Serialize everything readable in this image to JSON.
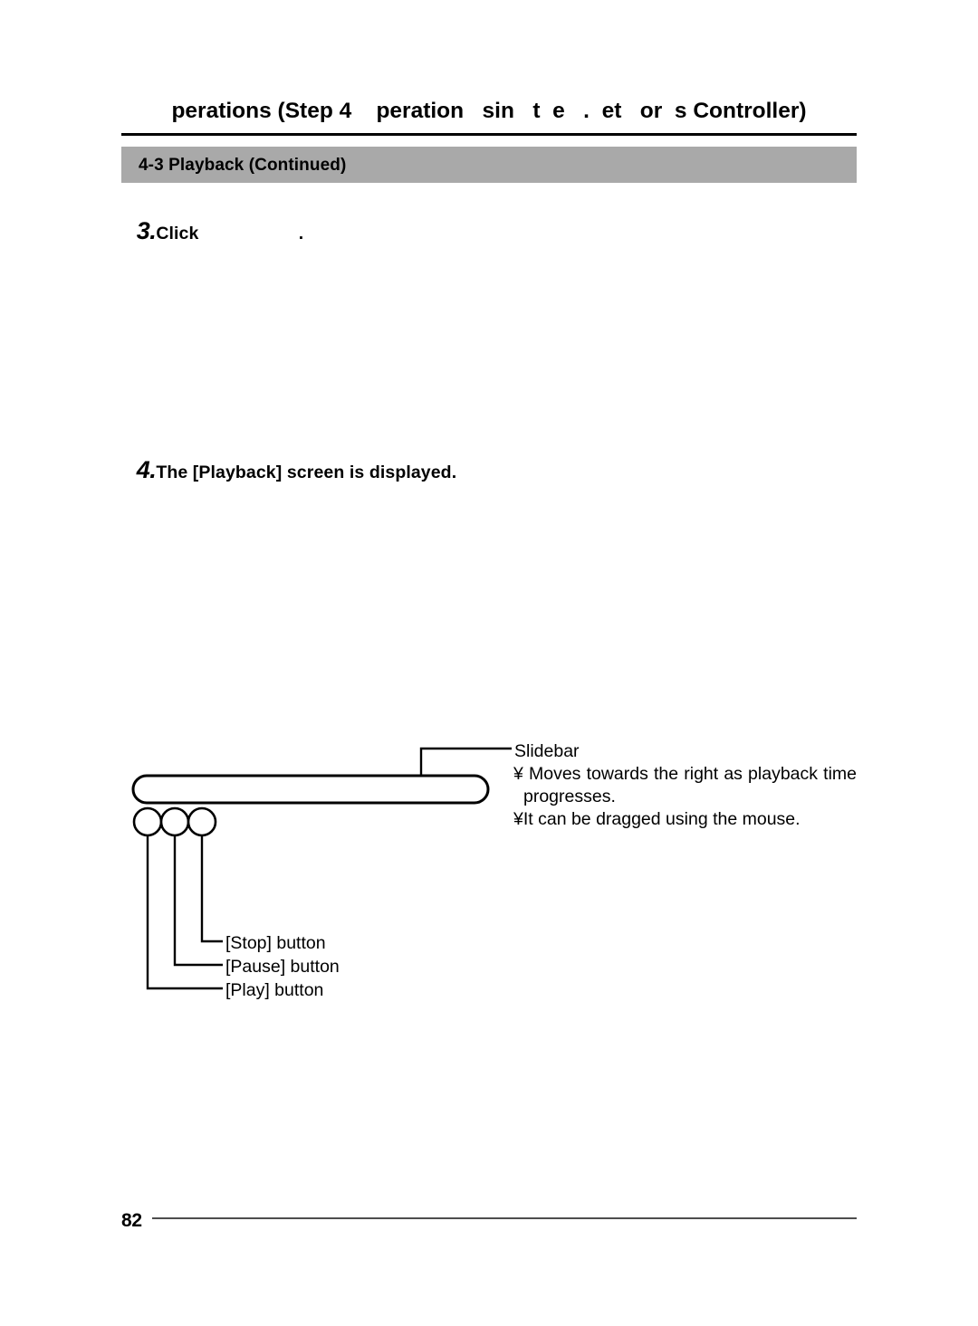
{
  "document": {
    "running_header": "perations (Step 4    peration   sin   t  e   .  et   or  s Controller)",
    "section_band_label": "4-3 Playback (Continued)",
    "page_number": "82"
  },
  "steps": [
    {
      "number": "3.",
      "text": "Click                    ."
    },
    {
      "number": "4.",
      "text": "The [Playback] screen is displayed."
    }
  ],
  "figure": {
    "slidebar_label": "Slidebar",
    "slidebar_notes": [
      "¥ Moves towards the right as playback time",
      "progresses.",
      "¥It can be dragged using the mouse."
    ],
    "button_callouts": [
      {
        "label": "[Stop] button"
      },
      {
        "label": "[Pause] button"
      },
      {
        "label": "[Play] button"
      }
    ]
  },
  "colors": {
    "band_gray": "#a9a9a9",
    "rule_black": "#000000",
    "footer_rule": "#4d4d4d",
    "page_background": "#ffffff"
  }
}
